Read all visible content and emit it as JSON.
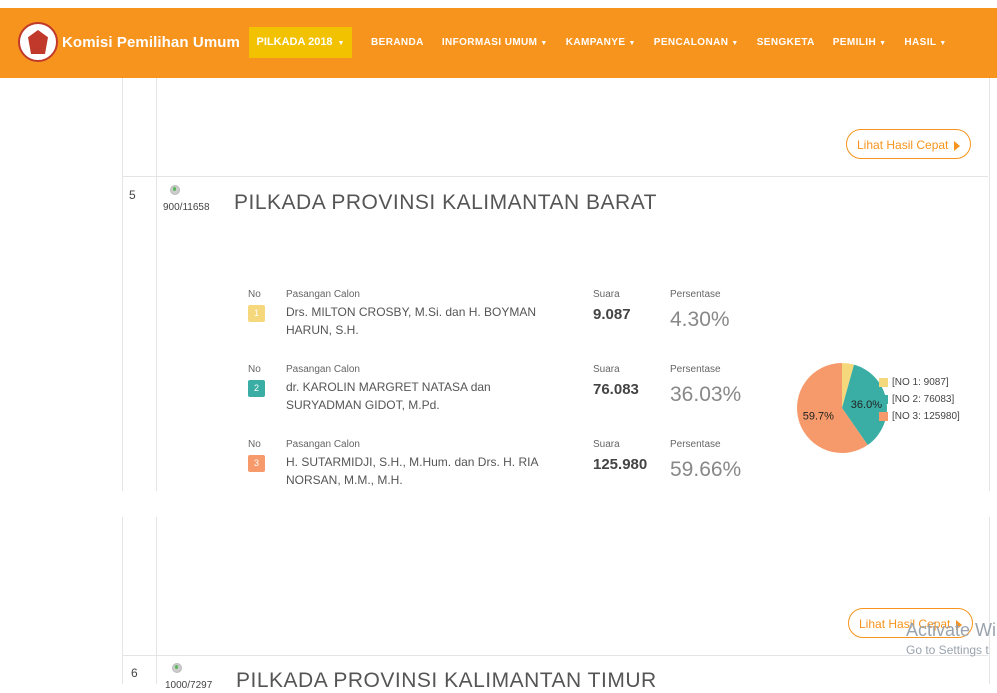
{
  "navbar": {
    "brand": "Komisi Pemilihan Umum",
    "pilkada_button": "PILKADA 2018",
    "items": [
      {
        "label": "BERANDA",
        "dropdown": false
      },
      {
        "label": "INFORMASI UMUM",
        "dropdown": true
      },
      {
        "label": "KAMPANYE",
        "dropdown": true
      },
      {
        "label": "PENCALONAN",
        "dropdown": true
      },
      {
        "label": "SENGKETA",
        "dropdown": false
      },
      {
        "label": "PEMILIH",
        "dropdown": true
      },
      {
        "label": "HASIL",
        "dropdown": true
      }
    ],
    "colors": {
      "bar": "#f7941d",
      "pilkada": "#f2c200"
    }
  },
  "quick_result_label": "Lihat Hasil Cepat",
  "sections": [
    {
      "number": "5",
      "progress": "900/11658",
      "title": "PILKADA PROVINSI KALIMANTAN BARAT",
      "labels": {
        "no": "No",
        "pair": "Pasangan Calon",
        "votes": "Suara",
        "percent": "Persentase"
      },
      "candidates": [
        {
          "no": "1",
          "name": "Drs. MILTON CROSBY, M.Si. dan H. BOYMAN HARUN, S.H.",
          "votes": "9.087",
          "percent": "4.30%",
          "color": "#f5d77c"
        },
        {
          "no": "2",
          "name": "dr. KAROLIN MARGRET NATASA dan SURYADMAN GIDOT, M.Pd.",
          "votes": "76.083",
          "percent": "36.03%",
          "color": "#3aaea4"
        },
        {
          "no": "3",
          "name": "H. SUTARMIDJI, S.H., M.Hum. dan Drs. H. RIA NORSAN, M.M., M.H.",
          "votes": "125.980",
          "percent": "59.66%",
          "color": "#f79a6b"
        }
      ],
      "chart_data": {
        "type": "pie",
        "series": [
          {
            "name": "[NO 1: 9087]",
            "value": 9087,
            "color": "#f5d77c"
          },
          {
            "name": "[NO 2: 76083]",
            "value": 76083,
            "color": "#3aaea4"
          },
          {
            "name": "[NO 3: 125980]",
            "value": 125980,
            "color": "#f79a6b"
          }
        ],
        "slice_labels": [
          "",
          "36.0%",
          "59.7%"
        ],
        "legend_position": "right"
      }
    },
    {
      "number": "6",
      "progress": "1000/7297",
      "title": "PILKADA PROVINSI KALIMANTAN TIMUR"
    }
  ],
  "watermark": {
    "line1": "Activate Wi",
    "line2": "Go to Settings t"
  }
}
